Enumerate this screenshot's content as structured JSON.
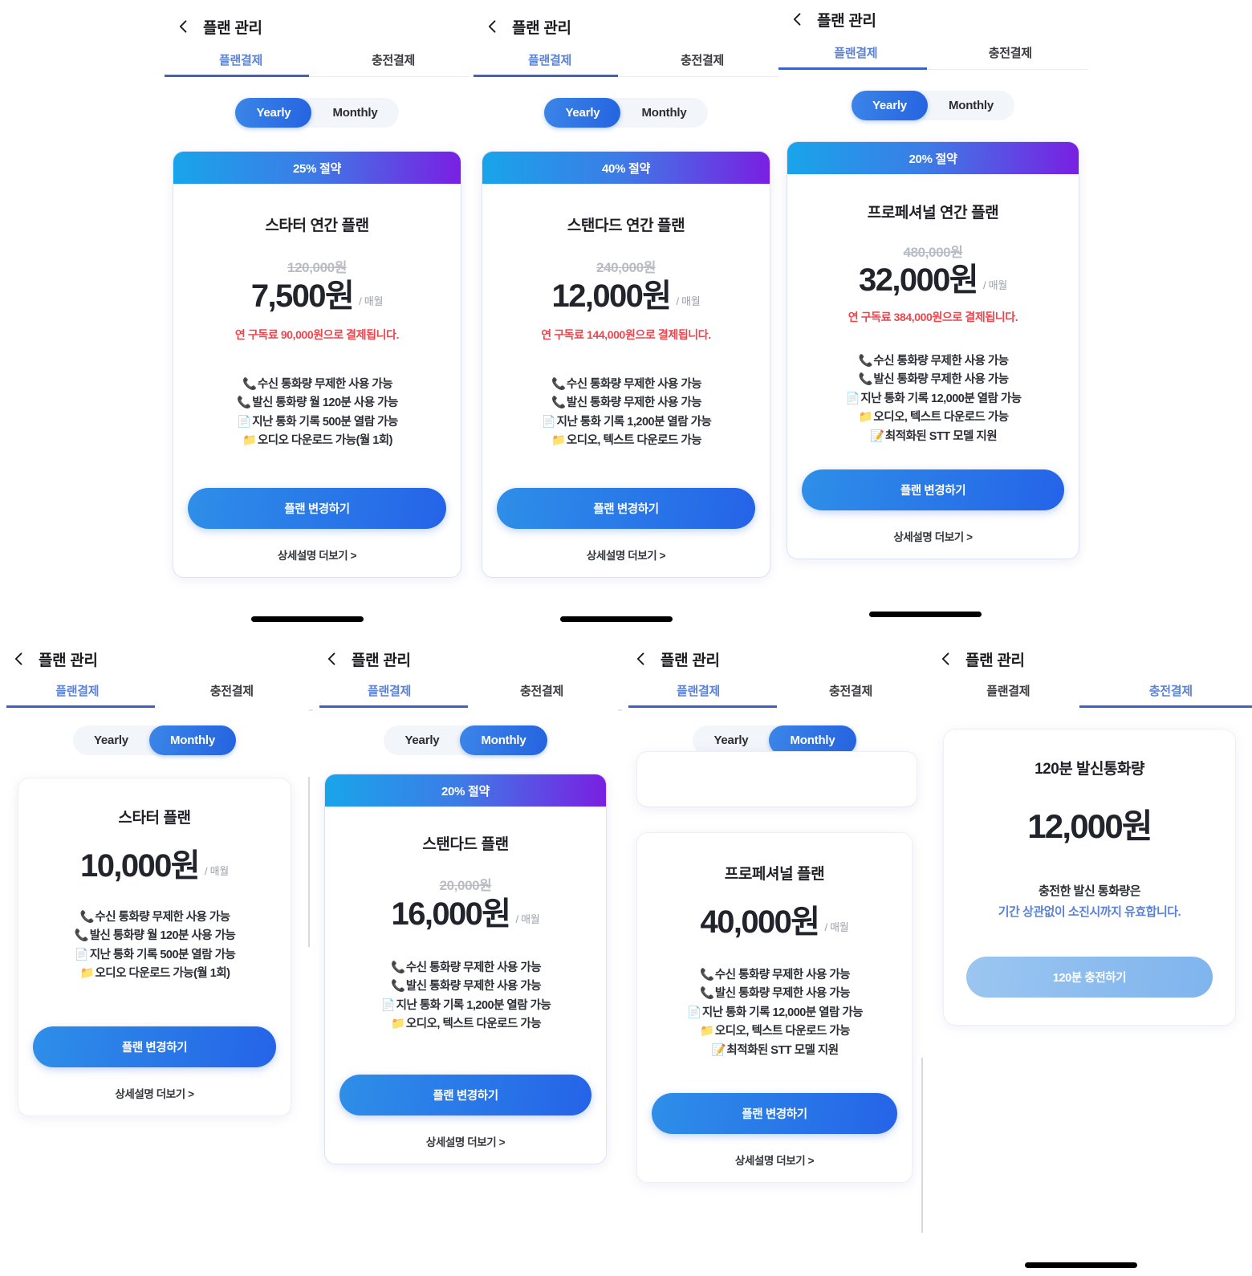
{
  "nav": {
    "back_icon": "chevron-left-icon",
    "title": "플랜 관리"
  },
  "tabs": {
    "plan": "플랜결제",
    "recharge": "충전결제"
  },
  "toggle": {
    "yearly": "Yearly",
    "monthly": "Monthly"
  },
  "labels": {
    "per_month": "/ 매월",
    "cta": "플랜 변경하기",
    "more": "상세설명 더보기 >",
    "phone_icon": "📞",
    "doc_icon": "📄",
    "folder_icon": "📁",
    "pencil_icon": "📝"
  },
  "colors": {
    "accent": "#2563E8",
    "tab_active": "#5B82D6",
    "tab_indicator": "#3C63C4",
    "ribbon_from": "#18A5EA",
    "ribbon_to": "#7A1FE2",
    "note_red": "#F0444C",
    "strike_gray": "#B9BCC4",
    "cta_muted": "#9BC6F0"
  },
  "screens": [
    {
      "id": "yearly-starter",
      "billing": "Yearly",
      "active_tab": "plan",
      "ribbon": "25% 절약",
      "plan_name": "스타터 연간 플랜",
      "old_price": "120,000원",
      "price": "7,500원",
      "note": "연 구독료 90,000원으로 결제됩니다.",
      "features": [
        {
          "icon": "📞",
          "text": "수신 통화량 무제한 사용 가능"
        },
        {
          "icon": "📞",
          "text": "발신 통화량 월 120분 사용 가능"
        },
        {
          "icon": "📄",
          "text": "지난 통화 기록 500분 열람 가능"
        },
        {
          "icon": "📁",
          "text": "오디오 다운로드 가능(월 1회)"
        }
      ]
    },
    {
      "id": "yearly-standard",
      "billing": "Yearly",
      "active_tab": "plan",
      "ribbon": "40% 절약",
      "plan_name": "스탠다드 연간 플랜",
      "old_price": "240,000원",
      "price": "12,000원",
      "note": "연 구독료 144,000원으로 결제됩니다.",
      "features": [
        {
          "icon": "📞",
          "text": "수신 통화량 무제한 사용 가능"
        },
        {
          "icon": "📞",
          "text": "발신 통화량 무제한 사용 가능"
        },
        {
          "icon": "📄",
          "text": "지난 통화 기록 1,200분 열람 가능"
        },
        {
          "icon": "📁",
          "text": "오디오, 텍스트 다운로드 가능"
        }
      ]
    },
    {
      "id": "yearly-professional",
      "billing": "Yearly",
      "active_tab": "plan",
      "ribbon": "20% 절약",
      "plan_name": "프로페셔널 연간 플랜",
      "old_price": "480,000원",
      "price": "32,000원",
      "note": "연 구독료 384,000원으로 결제됩니다.",
      "features": [
        {
          "icon": "📞",
          "text": "수신 통화량 무제한 사용 가능"
        },
        {
          "icon": "📞",
          "text": "발신 통화량 무제한 사용 가능"
        },
        {
          "icon": "📄",
          "text": "지난 통화 기록 12,000분 열람 가능"
        },
        {
          "icon": "📁",
          "text": "오디오, 텍스트 다운로드 가능"
        },
        {
          "icon": "📝",
          "text": "최적화된 STT 모델 지원"
        }
      ]
    },
    {
      "id": "monthly-starter",
      "billing": "Monthly",
      "active_tab": "plan",
      "ribbon": "",
      "plan_name": "스타터 플랜",
      "old_price": "",
      "price": "10,000원",
      "note": "",
      "features": [
        {
          "icon": "📞",
          "text": "수신 통화량 무제한 사용 가능"
        },
        {
          "icon": "📞",
          "text": "발신 통화량 월 120분 사용 가능"
        },
        {
          "icon": "📄",
          "text": "지난 통화 기록 500분 열람 가능"
        },
        {
          "icon": "📁",
          "text": "오디오 다운로드 가능(월 1회)"
        }
      ]
    },
    {
      "id": "monthly-standard",
      "billing": "Monthly",
      "active_tab": "plan",
      "ribbon": "20% 절약",
      "plan_name": "스탠다드 플랜",
      "old_price": "20,000원",
      "price": "16,000원",
      "note": "",
      "features": [
        {
          "icon": "📞",
          "text": "수신 통화량 무제한 사용 가능"
        },
        {
          "icon": "📞",
          "text": "발신 통화량 무제한 사용 가능"
        },
        {
          "icon": "📄",
          "text": "지난 통화 기록 1,200분 열람 가능"
        },
        {
          "icon": "📁",
          "text": "오디오, 텍스트 다운로드 가능"
        }
      ]
    },
    {
      "id": "monthly-professional",
      "billing": "Monthly",
      "active_tab": "plan",
      "ribbon": "",
      "plan_name": "프로페셔널 플랜",
      "old_price": "",
      "price": "40,000원",
      "note": "",
      "features": [
        {
          "icon": "📞",
          "text": "수신 통화량 무제한 사용 가능"
        },
        {
          "icon": "📞",
          "text": "발신 통화량 무제한 사용 가능"
        },
        {
          "icon": "📄",
          "text": "지난 통화 기록 12,000분 열람 가능"
        },
        {
          "icon": "📁",
          "text": "오디오, 텍스트 다운로드 가능"
        },
        {
          "icon": "📝",
          "text": "최적화된 STT 모델 지원"
        }
      ]
    }
  ],
  "recharge": {
    "active_tab": "recharge",
    "title": "120분 발신통화량",
    "price": "12,000원",
    "desc_line1": "충전한 발신 통화량은",
    "desc_line2": "기간 상관없이 소진시까지 유효합니다.",
    "cta": "120분 충전하기"
  }
}
